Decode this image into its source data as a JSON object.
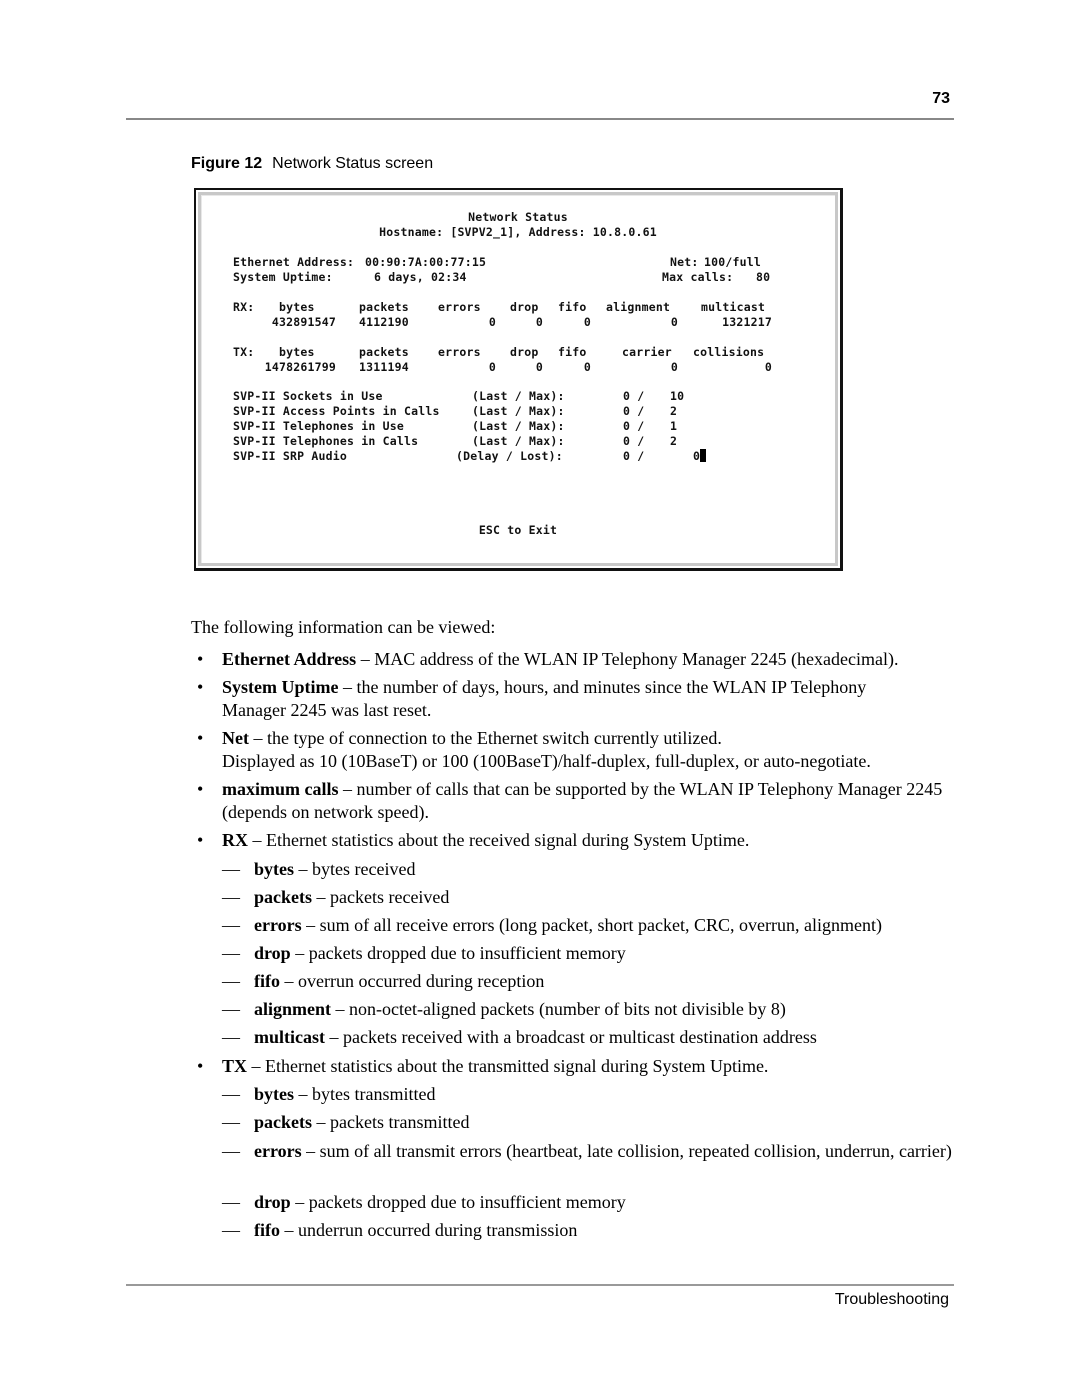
{
  "header": {
    "page_number": "73"
  },
  "figure": {
    "number": "Figure 12",
    "title": "Network Status screen",
    "screen": {
      "title": "Network Status",
      "hostname_line": "Hostname: [SVPV2_1], Address: 10.8.0.61",
      "ethernet_label": "Ethernet Address:",
      "ethernet_value": "00:90:7A:00:77:15",
      "net_label": "Net:",
      "net_value": "100/full",
      "uptime_label": "System Uptime:",
      "uptime_value": "6 days, 02:34",
      "maxcalls_label": "Max calls:",
      "maxcalls_value": "80",
      "rx": {
        "label": "RX:",
        "headers": [
          "bytes",
          "packets",
          "errors",
          "drop",
          "fifo",
          "alignment",
          "multicast"
        ],
        "values": [
          "432891547",
          "4112190",
          "0",
          "0",
          "0",
          "0",
          "1321217"
        ]
      },
      "tx": {
        "label": "TX:",
        "headers": [
          "bytes",
          "packets",
          "errors",
          "drop",
          "fifo",
          "carrier",
          "collisions"
        ],
        "values": [
          "1478261799",
          "1311194",
          "0",
          "0",
          "0",
          "0",
          "0"
        ]
      },
      "svp_rows": [
        {
          "label": "SVP-II Sockets in Use",
          "qualifier": "(Last / Max):",
          "last": "0 /",
          "max": "10"
        },
        {
          "label": "SVP-II Access Points in Calls",
          "qualifier": "(Last / Max):",
          "last": "0 /",
          "max": "2"
        },
        {
          "label": "SVP-II Telephones in Use",
          "qualifier": "(Last / Max):",
          "last": "0 /",
          "max": "1"
        },
        {
          "label": "SVP-II Telephones in Calls",
          "qualifier": "(Last / Max):",
          "last": "0 /",
          "max": "2"
        },
        {
          "label": "SVP-II SRP Audio",
          "qualifier": "(Delay / Lost):",
          "last": "0 /",
          "max": "0"
        }
      ],
      "exit_hint": "ESC to Exit"
    }
  },
  "body": {
    "intro": "The following information can be viewed:",
    "bullet_mark": "•",
    "dash_mark": "—",
    "items": [
      {
        "term": "Ethernet Address",
        "text": " – MAC address of the WLAN IP Telephony Manager 2245 (hexadecimal)."
      },
      {
        "term": "System Uptime",
        "text": " – the number of days, hours, and minutes since the WLAN IP Telephony Manager 2245 was last reset."
      },
      {
        "term": "Net",
        "text": " – the type of connection to the Ethernet switch currently utilized.",
        "extra": "Displayed as 10 (10BaseT) or 100 (100BaseT)/half-duplex, full-duplex, or auto-negotiate."
      },
      {
        "term": "maximum calls",
        "text": " – number of calls that can be supported by the WLAN IP Telephony Manager 2245 (depends on network speed)."
      },
      {
        "term": "RX",
        "text": " – Ethernet statistics about the received signal during System Uptime."
      },
      {
        "term": "TX",
        "text": " – Ethernet statistics about the transmitted signal during System Uptime."
      }
    ],
    "rx_sub": [
      {
        "term": "bytes",
        "text": " – bytes received"
      },
      {
        "term": "packets",
        "text": " – packets received"
      },
      {
        "term": "errors",
        "text": " – sum of all receive errors (long packet, short packet, CRC, overrun, alignment)"
      },
      {
        "term": "drop",
        "text": " – packets dropped due to insufficient memory"
      },
      {
        "term": "fifo",
        "text": " – overrun occurred during reception"
      },
      {
        "term": "alignment",
        "text": " – non-octet-aligned packets (number of bits not divisible by 8)"
      },
      {
        "term": "multicast",
        "text": " – packets received with a broadcast or multicast destination address"
      }
    ],
    "tx_sub": [
      {
        "term": "bytes",
        "text": " – bytes transmitted"
      },
      {
        "term": "packets",
        "text": " – packets transmitted"
      },
      {
        "term": "errors",
        "text": " – sum of all transmit errors (heartbeat, late collision, repeated collision, underrun, carrier)"
      },
      {
        "term": "drop",
        "text": " – packets dropped due to insufficient memory"
      },
      {
        "term": "fifo",
        "text": " – underrun occurred during transmission"
      }
    ]
  },
  "footer": {
    "section": "Troubleshooting"
  }
}
